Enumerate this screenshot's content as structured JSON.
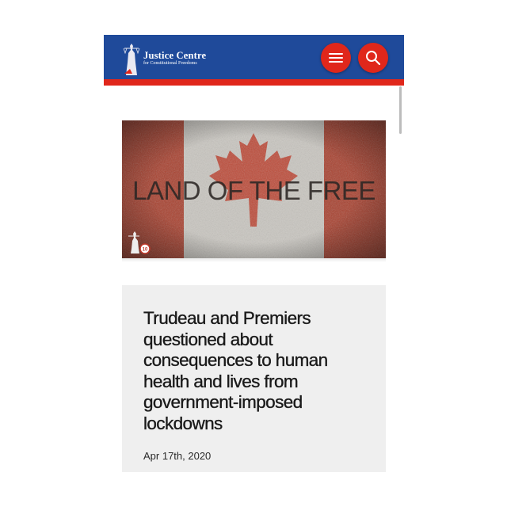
{
  "header": {
    "logo_title": "Justice Centre",
    "logo_subtitle": "for Constitutional Freedoms",
    "menu_icon": "hamburger-menu-icon",
    "search_icon": "search-icon",
    "colors": {
      "header_bg": "#1f4a9a",
      "accent": "#e0271b"
    }
  },
  "hero": {
    "image": "canadian-flag-grunge",
    "caption": "LAND OF THE FREE",
    "badge_icon": "justice-anniversary-badge-icon"
  },
  "article": {
    "title": "Trudeau and Premiers questioned about consequences to human health and lives from government-imposed lockdowns",
    "date": "Apr 17th, 2020"
  }
}
